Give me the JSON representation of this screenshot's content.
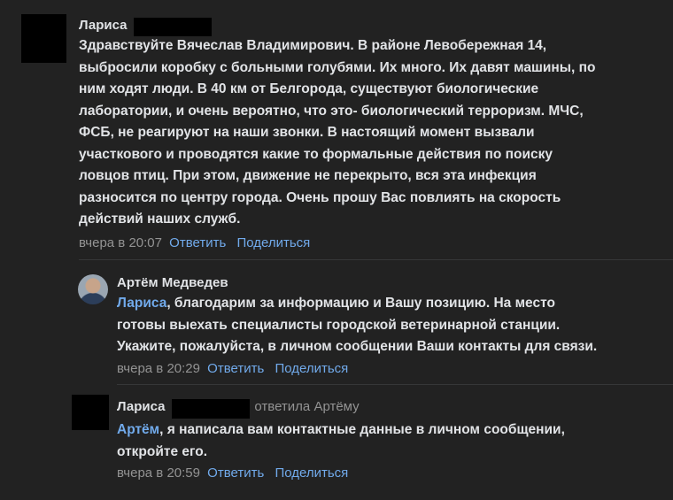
{
  "comments": [
    {
      "author": "Лариса",
      "lines": [
        "Здравствуйте Вячеслав Владимирович. В районе Левобережная 14,",
        "выбросили коробку с больными голубями. Их много. Их давят машины, по",
        "ним ходят люди. В 40 км от Белгорода, существуют биологические",
        "лаборатории, и очень вероятно, что это- биологический терроризм. МЧС,",
        "ФСБ, не реагируют на наши звонки. В настоящий момент вызвали",
        "участкового и проводятся какие то формальные действия по поиску",
        "ловцов птиц. При этом, движение не перекрыто, вся эта инфекция",
        "разносится по центру города. Очень прошу Вас повлиять на скорость",
        "действий наших служб."
      ],
      "time": "вчера в 20:07",
      "reply_label": "Ответить",
      "share_label": "Поделиться"
    },
    {
      "author": "Артём Медведев",
      "mention": "Лариса",
      "line1_rest": ", благодарим за информацию и Вашу позицию. На место",
      "lines": [
        "готовы выехать специалисты городской ветеринарной станции.",
        "Укажите, пожалуйста, в личном сообщении Ваши контакты для связи."
      ],
      "time": "вчера в 20:29",
      "reply_label": "Ответить",
      "share_label": "Поделиться"
    },
    {
      "author": "Лариса",
      "replied_to": "ответила Артёму",
      "mention": "Артём",
      "line1_rest": ", я написала вам контактные данные в личном сообщении,",
      "lines": [
        "откройте его."
      ],
      "time": "вчера в 20:59",
      "reply_label": "Ответить",
      "share_label": "Поделиться"
    }
  ]
}
